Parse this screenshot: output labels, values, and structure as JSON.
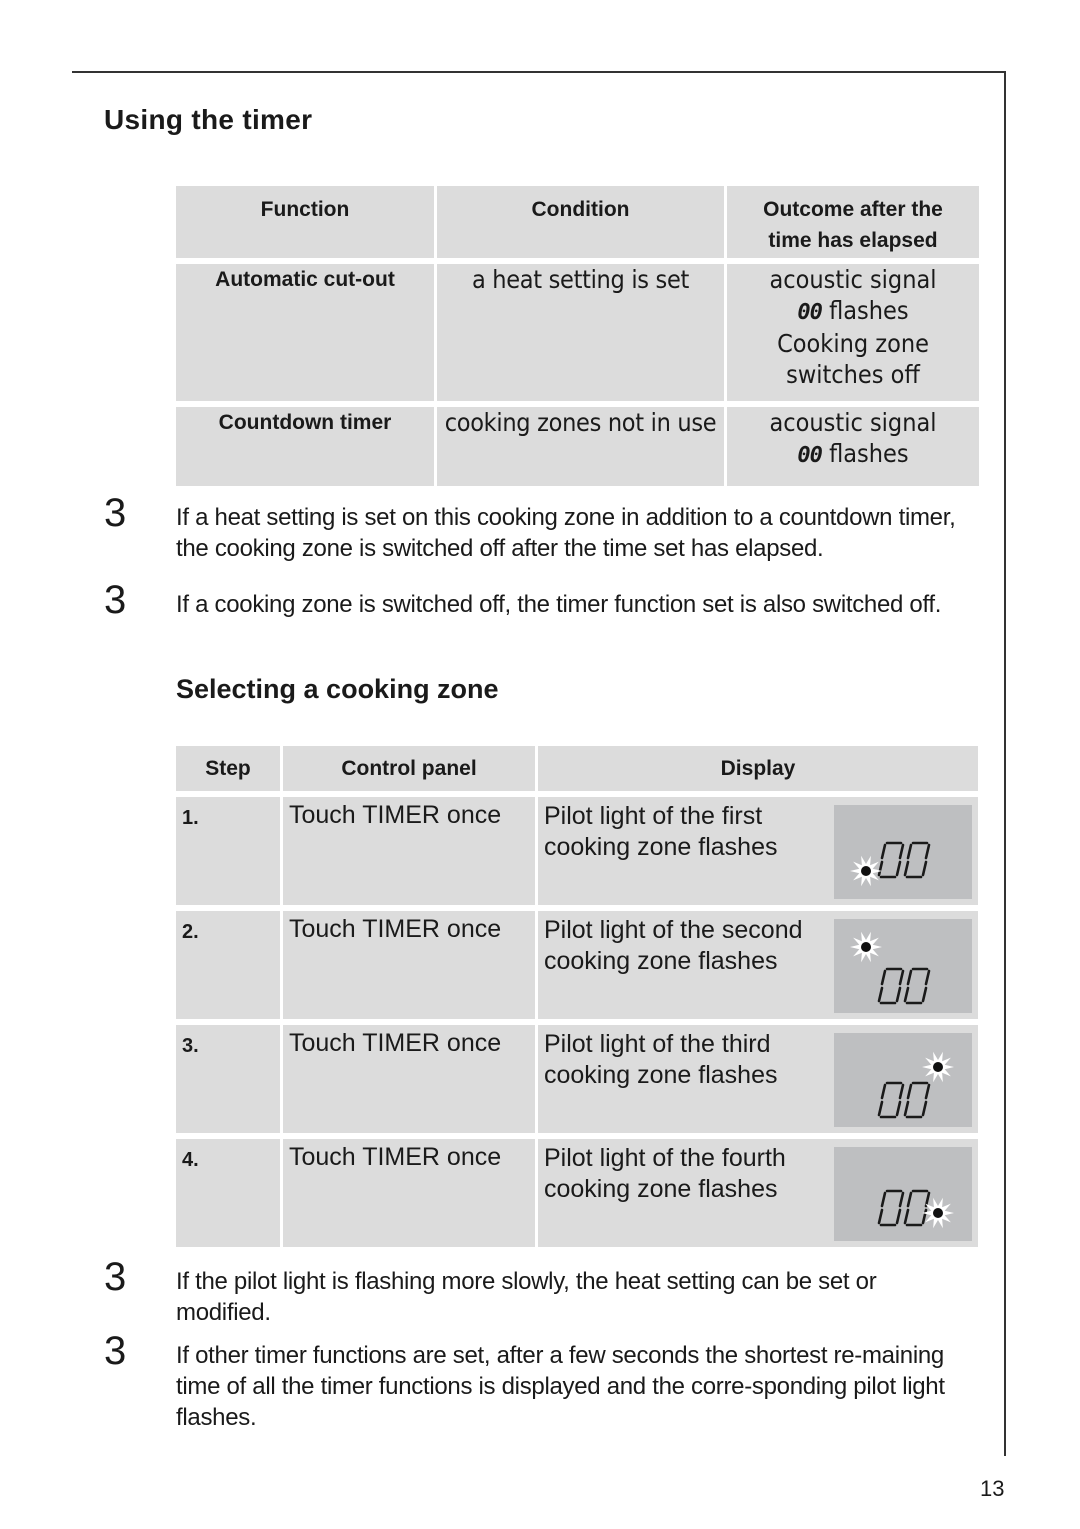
{
  "page": {
    "title": "Using the timer",
    "page_number": "13"
  },
  "timer_table": {
    "headers": [
      "Function",
      "Condition",
      "Outcome after the",
      "time has elapsed"
    ],
    "rows": [
      {
        "function": "Automatic cut-out",
        "condition": "a heat setting is set",
        "outcome": [
          "acoustic signal",
          "00",
          "flashes",
          "Cooking zone",
          "switches off"
        ]
      },
      {
        "function": "Countdown timer",
        "condition": "cooking zones not in use",
        "outcome": [
          "acoustic signal",
          "00",
          "flashes"
        ]
      }
    ]
  },
  "notes_top": [
    {
      "bullet": "3",
      "text": "If a heat setting is set on this cooking zone in addition to a countdown timer, the cooking zone is switched off after the time set has elapsed."
    },
    {
      "bullet": "3",
      "text": "If a cooking zone is switched off, the timer function set is also switched off."
    }
  ],
  "section2": {
    "title": "Selecting a cooking zone"
  },
  "steps_table": {
    "headers": [
      "Step",
      "Control panel",
      "Display"
    ],
    "rows": [
      {
        "step": "1.",
        "control": "Touch TIMER once",
        "display": "Pilot light of the first cooking zone flashes",
        "lcd": "00",
        "pilot": "bottom-left"
      },
      {
        "step": "2.",
        "control": "Touch TIMER once",
        "display": "Pilot light of the second cooking zone flashes",
        "lcd": "00",
        "pilot": "top-left"
      },
      {
        "step": "3.",
        "control": "Touch TIMER once",
        "display": "Pilot light of the third cooking zone flashes",
        "lcd": "00",
        "pilot": "top-right"
      },
      {
        "step": "4.",
        "control": "Touch TIMER once",
        "display": "Pilot light of the fourth cooking zone flashes",
        "lcd": "00",
        "pilot": "bottom-right"
      }
    ]
  },
  "notes_bottom": [
    {
      "bullet": "3",
      "text": "If the pilot light is flashing more slowly, the heat setting can be set or modified."
    },
    {
      "bullet": "3",
      "text": "If other timer functions are set, after a few seconds the shortest re-maining time of all the timer functions is displayed and the corre-sponding pilot light flashes."
    }
  ]
}
